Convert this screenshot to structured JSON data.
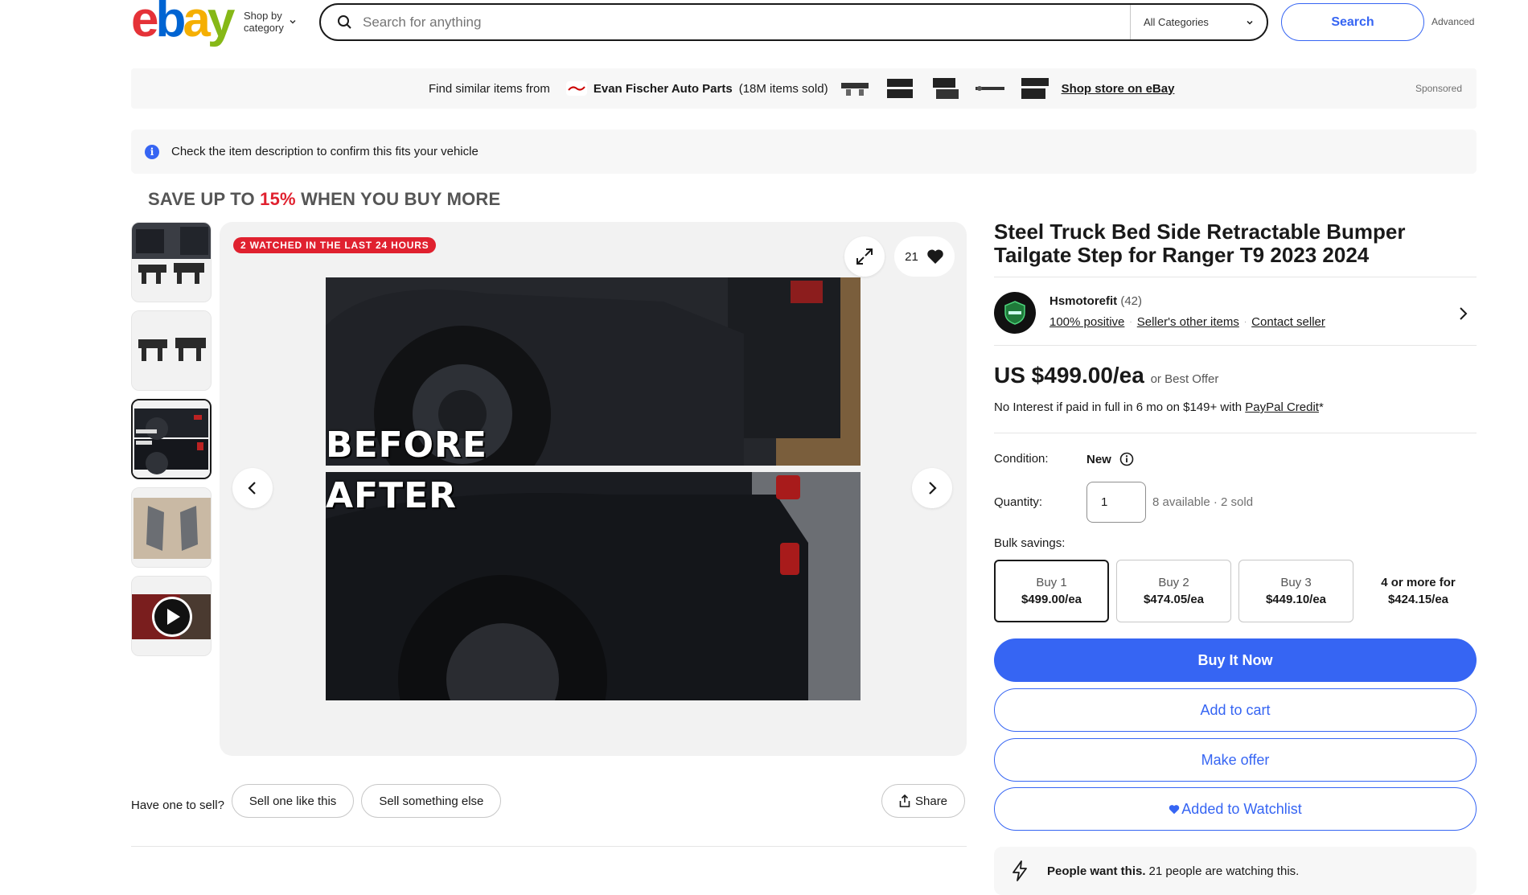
{
  "header": {
    "logo": "ebay",
    "shop_by_category": [
      "Shop by",
      "category"
    ],
    "search_placeholder": "Search for anything",
    "category_select": "All Categories",
    "search_button": "Search",
    "advanced_link": "Advanced"
  },
  "store_banner": {
    "find_text": "Find similar items from",
    "store_name": "Evan Fischer Auto Parts",
    "sold_text": "(18M items sold)",
    "shop_link": "Shop store on eBay",
    "sponsored": "Sponsored"
  },
  "notice": {
    "text": "Check the item description to confirm this fits your vehicle"
  },
  "promo": {
    "prefix": "SAVE UP TO",
    "percent": "15%",
    "suffix": "WHEN YOU BUY MORE"
  },
  "gallery": {
    "watched_badge": "2 WATCHED IN THE LAST 24 HOURS",
    "watch_count": "21",
    "photo_labels": [
      "BEFORE",
      "AFTER"
    ],
    "selected_thumbnail": 3
  },
  "sell_bar": {
    "prompt": "Have one to sell?",
    "sell_like": "Sell one like this",
    "sell_else": "Sell something else",
    "share": "Share"
  },
  "item": {
    "title": "Steel Truck Bed Side Retractable Bumper Tailgate Step for Ranger T9 2023 2024",
    "seller": {
      "name": "Hsmotorefit",
      "feedback_count": "(42)",
      "positive": "100% positive",
      "other_items": "Seller's other items",
      "contact": "Contact seller"
    },
    "price": "US $499.00/ea",
    "best_offer": "or Best Offer",
    "credit_text": "No Interest if paid in full in 6 mo on $149+ with",
    "credit_link": "PayPal Credit",
    "credit_suffix": "*",
    "condition_label": "Condition:",
    "condition_value": "New",
    "quantity_label": "Quantity:",
    "quantity_value": "1",
    "availability": "8 available · 2 sold",
    "bulk_label": "Bulk savings:",
    "bulk": [
      {
        "qty": "Buy 1",
        "price": "$499.00/ea"
      },
      {
        "qty": "Buy 2",
        "price": "$474.05/ea"
      },
      {
        "qty": "Buy 3",
        "price": "$449.10/ea"
      },
      {
        "qty": "4 or more for",
        "price": "$424.15/ea"
      }
    ],
    "buy_now": "Buy It Now",
    "add_to_cart": "Add to cart",
    "make_offer": "Make offer",
    "watchlist": "Added to Watchlist",
    "people_bold": "People want this.",
    "people_text": "21 people are watching this."
  },
  "colors": {
    "accent": "#3665f3",
    "badge_red": "#e0212f"
  }
}
